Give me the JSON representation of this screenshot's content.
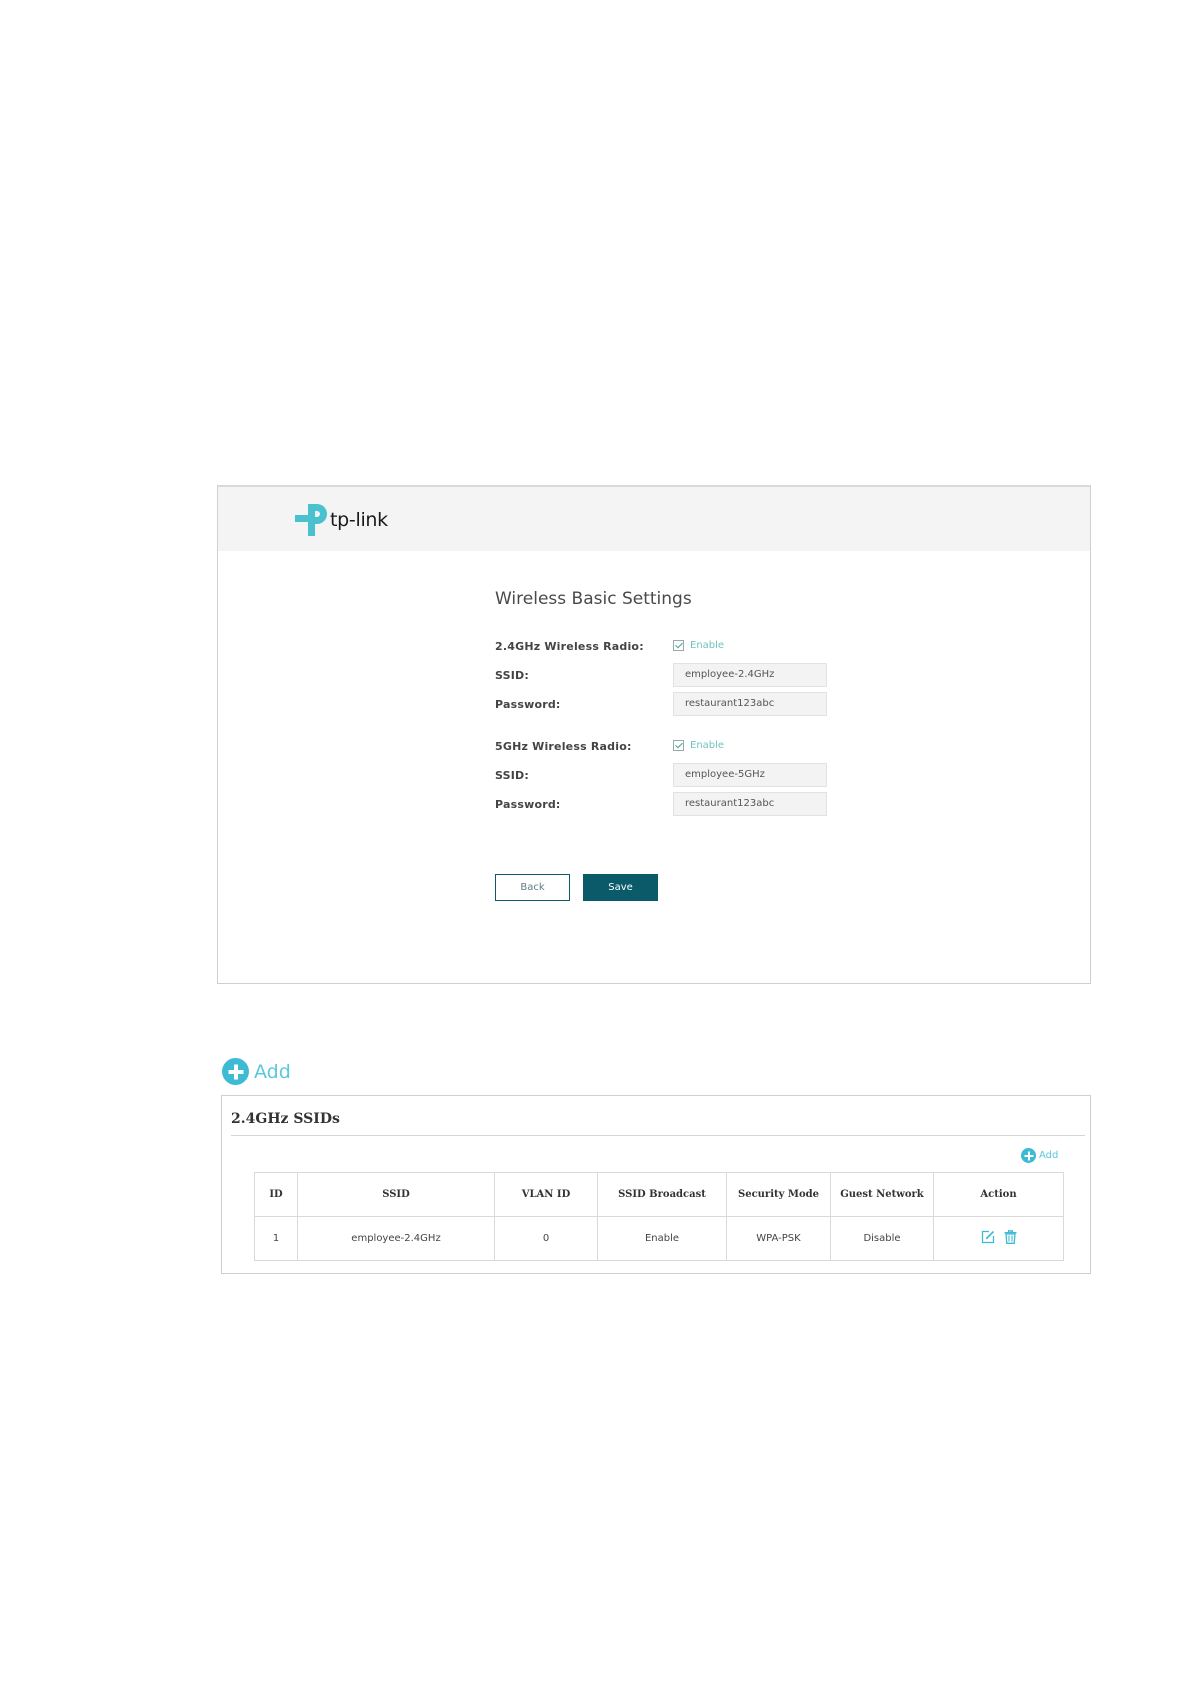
{
  "brand": {
    "logo_text": "tp-link",
    "accent_color": "#4ac1cf"
  },
  "wireless_form": {
    "title": "Wireless Basic Settings",
    "band_24": {
      "radio_label": "2.4GHz Wireless Radio:",
      "enable_label": "Enable",
      "enabled": true,
      "ssid_label": "SSID:",
      "ssid_value": "employee-2.4GHz",
      "password_label": "Password:",
      "password_value": "restaurant123abc"
    },
    "band_5": {
      "radio_label": "5GHz Wireless Radio:",
      "enable_label": "Enable",
      "enabled": true,
      "ssid_label": "SSID:",
      "ssid_value": "employee-5GHz",
      "password_label": "Password:",
      "password_value": "restaurant123abc"
    },
    "back_label": "Back",
    "save_label": "Save",
    "save_color": "#0b5a6a"
  },
  "add_link": {
    "label": "Add",
    "icon": "plus-circle-icon",
    "color": "#3dbbd5"
  },
  "ssid_section": {
    "title": "2.4GHz SSIDs",
    "add_label": "Add",
    "columns": [
      "ID",
      "SSID",
      "VLAN ID",
      "SSID Broadcast",
      "Security Mode",
      "Guest Network",
      "Action"
    ],
    "rows": [
      {
        "id": "1",
        "ssid": "employee-2.4GHz",
        "vlan_id": "0",
        "ssid_broadcast": "Enable",
        "security_mode": "WPA-PSK",
        "guest_network": "Disable",
        "actions": [
          "edit-icon",
          "delete-icon"
        ]
      }
    ]
  }
}
